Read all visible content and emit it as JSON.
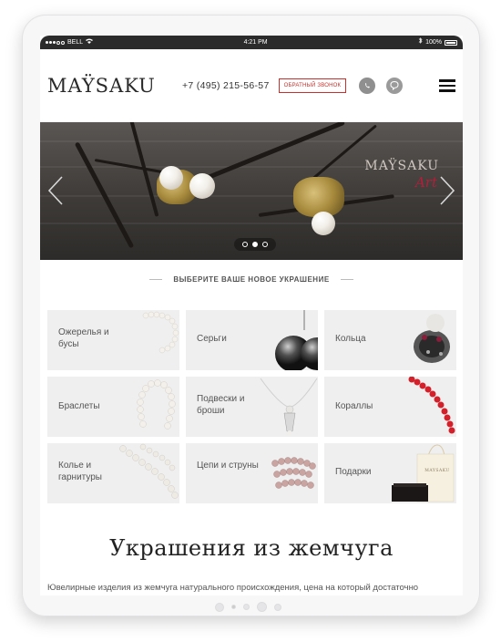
{
  "status_bar": {
    "carrier": "BELL",
    "time": "4:21 PM",
    "battery": "100%"
  },
  "header": {
    "logo": "MAŸSAKU",
    "phone": "+7 (495) 215-56-57",
    "callback_label": "ОБРАТНЫЙ ЗВОНОК",
    "whatsapp_icon": "whatsapp-icon",
    "viber_icon": "viber-icon",
    "menu_icon": "hamburger-menu-icon"
  },
  "hero": {
    "brand": "MAŸSAKU",
    "brand_sub": "Art",
    "slides_count": 3,
    "active_slide": 2
  },
  "section_title": "ВЫБЕРИТЕ ВАШЕ НОВОЕ УКРАШЕНИЕ",
  "categories": [
    {
      "label": "Ожерелья и бусы"
    },
    {
      "label": "Серьги"
    },
    {
      "label": "Кольца"
    },
    {
      "label": "Браслеты"
    },
    {
      "label": "Подвески и броши"
    },
    {
      "label": "Кораллы"
    },
    {
      "label": "Колье и гарнитуры"
    },
    {
      "label": "Цепи и струны"
    },
    {
      "label": "Подарки"
    }
  ],
  "gift_bag_text": "MAYSAKU",
  "main_heading": "Украшения из жемчуга",
  "description": "Ювелирные изделия из жемчуга натурального происхождения, цена на который достаточно",
  "colors": {
    "accent": "#c9302c",
    "card_bg": "#efefef",
    "status_bar": "#2b2b2b"
  }
}
